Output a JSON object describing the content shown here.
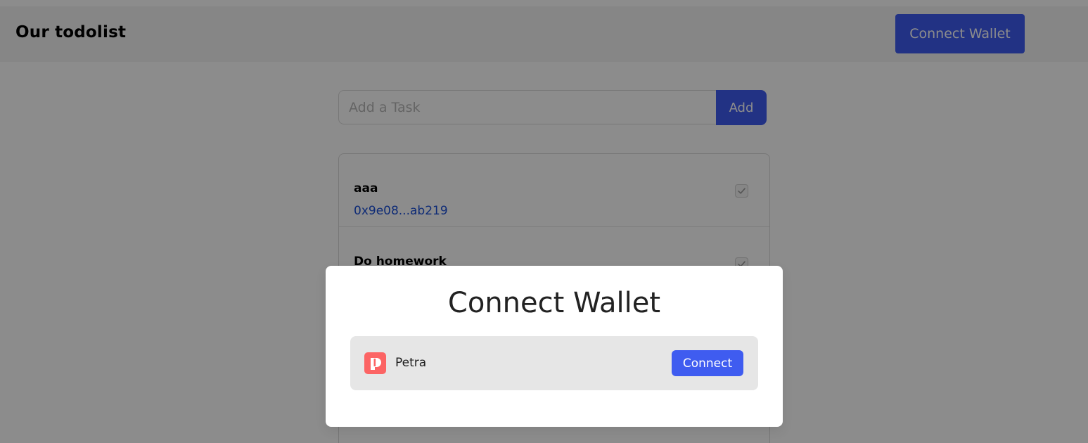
{
  "header": {
    "brand": "Our todolist",
    "connect_label": "Connect Wallet"
  },
  "task_form": {
    "placeholder": "Add a Task",
    "add_label": "Add"
  },
  "tasks": [
    {
      "title": "aaa",
      "address": "0x9e08...ab219",
      "checked": true
    },
    {
      "title": "Do homework",
      "address": "",
      "checked": true
    }
  ],
  "modal": {
    "title": "Connect Wallet",
    "wallets": [
      {
        "name": "Petra",
        "icon": "petra-logo-icon",
        "connect_label": "Connect",
        "brand_color": "#fc6464"
      }
    ]
  },
  "colors": {
    "accent": "#3f5cf0",
    "link": "#1a4fd8"
  }
}
